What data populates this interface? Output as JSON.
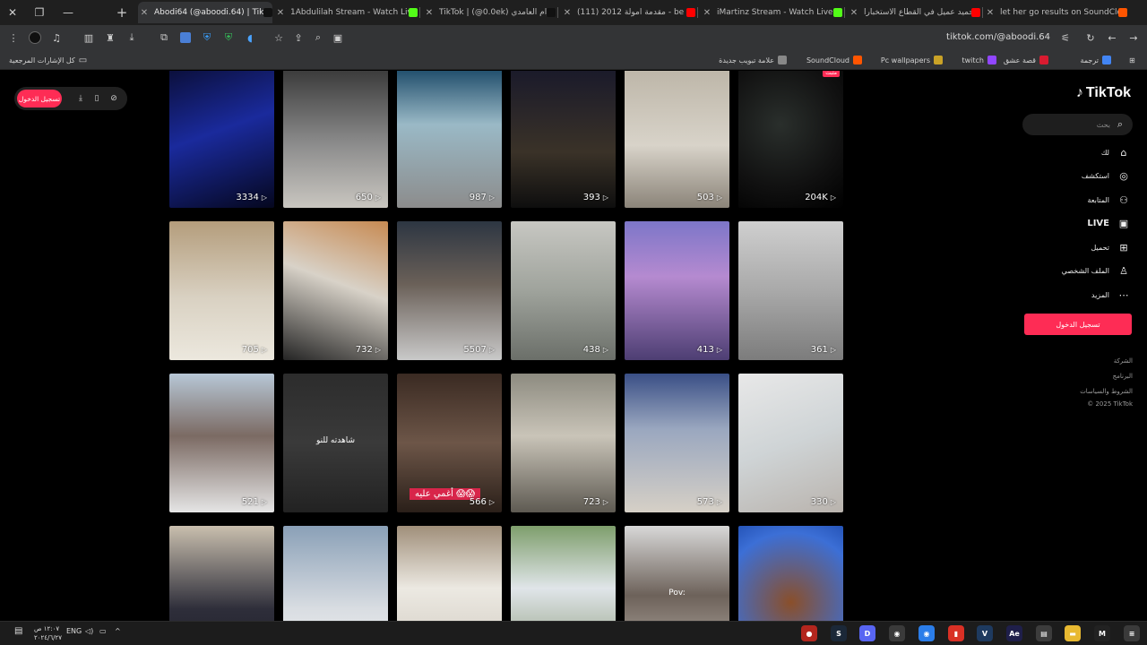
{
  "browser": {
    "tabs": [
      {
        "title": "Abodi64 (@aboodi.64) | TikTok",
        "active": true,
        "favicon_color": "#111111"
      },
      {
        "title": "1Abdulilah Stream - Watch Live",
        "favicon_color": "#53fc18"
      },
      {
        "title": "TikTok | ‏(@0.0ek) رام العامدي",
        "favicon_color": "#111111"
      },
      {
        "title": "(111) مقدمة امولة 2012 - be",
        "favicon_color": "#ff0000"
      },
      {
        "title": "iMartinz Stream - Watch Live o",
        "favicon_color": "#53fc18"
      },
      {
        "title": "حميد عميل في القطاع الاستخبارا",
        "favicon_color": "#ff0000"
      },
      {
        "title": "let her go results on SoundClou",
        "favicon_color": "#ff5500"
      }
    ],
    "new_tab_symbol": "+",
    "address": "tiktok.com/@aboodi.64"
  },
  "bookmarks": {
    "all_bookmarks": "كل الإشارات المرجعية",
    "items": [
      {
        "label": "ترجمة",
        "color": "#4285f4"
      },
      {
        "label": "قصة عشق",
        "color": "#d81b30"
      },
      {
        "label": "twitch",
        "color": "#9146ff"
      },
      {
        "label": "Pc wallpapers",
        "color": "#c9a227"
      },
      {
        "label": "SoundCloud",
        "color": "#ff5500"
      },
      {
        "label": "علامة تبويب جديدة",
        "color": "#888888"
      }
    ]
  },
  "extension": {
    "login_label": "تسجيل الدخول"
  },
  "videos": [
    {
      "views": "3334",
      "bg": "linear-gradient(160deg,#0b0f3a 0%,#1a2a9c 45%,#05071e 100%)"
    },
    {
      "views": "650",
      "bg": "linear-gradient(180deg,#3a3a3a 0%,#8d8d8d 55%,#c9c6c0 100%)"
    },
    {
      "views": "987",
      "bg": "linear-gradient(180deg,#1f4d6b 0%,#9ab9c6 40%,#8c8c8c 100%)"
    },
    {
      "views": "393",
      "bg": "linear-gradient(180deg,#1a1a2a 0%,#3a3228 60%,#0e0e0e 100%)"
    },
    {
      "views": "503",
      "bg": "linear-gradient(180deg,#bdb6a8 0%,#d8d3c9 55%,#8b8479 100%)"
    },
    {
      "views": "204K",
      "bg": "radial-gradient(circle at 40% 40%,#2a2f2c 0%,#111 60%,#000 100%)"
    },
    {
      "views": "705",
      "bg": "linear-gradient(180deg,#b49d7c 0%,#d9d1c2 55%,#ece8de 100%)"
    },
    {
      "views": "732",
      "bg": "linear-gradient(200deg,#c78a52 0%,#d8d2c8 45%,#242424 100%)"
    },
    {
      "views": "5507",
      "bg": "linear-gradient(180deg,#2d3642 0%,#6a6058 45%,#c9c9c9 100%)"
    },
    {
      "views": "438",
      "bg": "linear-gradient(180deg,#c7c7c2 0%,#9fa39c 50%,#6b6f69 100%)"
    },
    {
      "views": "413",
      "bg": "linear-gradient(180deg,#7d76c8 0%,#b58ad0 40%,#4d3e73 100%)"
    },
    {
      "views": "361",
      "bg": "linear-gradient(180deg,#cfcfcf 0%,#a9a9a9 50%,#7c7c7c 100%)"
    },
    {
      "views": "521",
      "bg": "linear-gradient(180deg,#b7c7d6 0%,#7b6a63 45%,#e5e5e5 100%)"
    },
    {
      "views": "",
      "caption": "شاهدته للنو",
      "bg": "linear-gradient(180deg,#2c2c2c 0%,#3a3a3a 50%,#222 100%)"
    },
    {
      "views": "566",
      "red_caption": "أغمي عليه 😱😱",
      "bg": "linear-gradient(180deg,#3a2a22 0%,#6d5648 50%,#2a1f19 100%)"
    },
    {
      "views": "723",
      "bg": "linear-gradient(180deg,#8d8b80 0%,#c9c4b8 45%,#5e5a52 100%)"
    },
    {
      "views": "573",
      "bg": "linear-gradient(180deg,#3a4f86 0%,#9aa7bf 40%,#d6d0c6 100%)"
    },
    {
      "views": "330",
      "bg": "linear-gradient(160deg,#e8e8e8 0%,#cfd4d6 50%,#b9b3ad 100%)"
    },
    {
      "views": "",
      "bg": "linear-gradient(180deg,#c9bfae 0%,#2e2e3a 60%,#1d1d28 100%)"
    },
    {
      "views": "",
      "bg": "linear-gradient(180deg,#8aa0b7 0%,#d9dde2 60%,#f0f0f0 100%)"
    },
    {
      "views": "",
      "bg": "linear-gradient(180deg,#a08f7a 0%,#ece9e2 45%,#cfc9bf 100%)"
    },
    {
      "views": "",
      "bg": "linear-gradient(180deg,#7e9e6c 0%,#e0e5e9 45%,#8a9a7a 100%)"
    },
    {
      "views": "",
      "caption": "Pov:",
      "bg": "linear-gradient(180deg,#d8d8d8 0%,#6d625a 50%,#b8b0a6 100%)"
    },
    {
      "views": "",
      "bg": "radial-gradient(circle at 50% 55%,#8a4f2a 0%,#3c6fd6 75%,#2554b8 100%)"
    }
  ],
  "sidebar": {
    "logo_text": "TikTok",
    "search_placeholder": "بحث",
    "nav": [
      {
        "label": "لك",
        "icon": "home-icon",
        "glyph": "⌂"
      },
      {
        "label": "استكشف",
        "icon": "compass-icon",
        "glyph": "◎"
      },
      {
        "label": "المتابعة",
        "icon": "following-icon",
        "glyph": "⚇"
      },
      {
        "label": "LIVE",
        "icon": "live-icon",
        "glyph": "▣"
      },
      {
        "label": "تحميل",
        "icon": "upload-icon",
        "glyph": "⊞"
      },
      {
        "label": "الملف الشخصي",
        "icon": "profile-icon",
        "glyph": "♙"
      },
      {
        "label": "المزيد",
        "icon": "more-icon",
        "glyph": "⋯"
      }
    ],
    "login_label": "تسجيل الدخول",
    "footer": [
      "الشركة",
      "البرنامج",
      "الشروط والسياسات",
      "© 2025 TikTok"
    ]
  },
  "taskbar": {
    "time": "١٢:٠٧ ص",
    "date": "٢٠٢٤/٦/٢٧",
    "lang": "ENG",
    "apps": [
      {
        "name": "red-app-icon",
        "color": "#b3261e",
        "glyph": "●"
      },
      {
        "name": "steam-icon",
        "color": "#1b2838",
        "glyph": "S"
      },
      {
        "name": "discord-icon",
        "color": "#5865f2",
        "glyph": "D"
      },
      {
        "name": "chrome-dev-icon",
        "color": "#3a3a3a",
        "glyph": "◉"
      },
      {
        "name": "chrome-icon",
        "color": "#2b7de9",
        "glyph": "◉"
      },
      {
        "name": "red-square-icon",
        "color": "#d93025",
        "glyph": "▮"
      },
      {
        "name": "v-app-icon",
        "color": "#1e3a5f",
        "glyph": "V"
      },
      {
        "name": "after-effects-icon",
        "color": "#1f1f4a",
        "glyph": "Ae"
      },
      {
        "name": "store-icon",
        "color": "#3c3c3c",
        "glyph": "▤"
      },
      {
        "name": "folder-icon",
        "color": "#e8b931",
        "glyph": "▬"
      },
      {
        "name": "capcut-icon",
        "color": "#222222",
        "glyph": "M"
      },
      {
        "name": "menu-app-icon",
        "color": "#3a3a3a",
        "glyph": "≡"
      }
    ]
  }
}
